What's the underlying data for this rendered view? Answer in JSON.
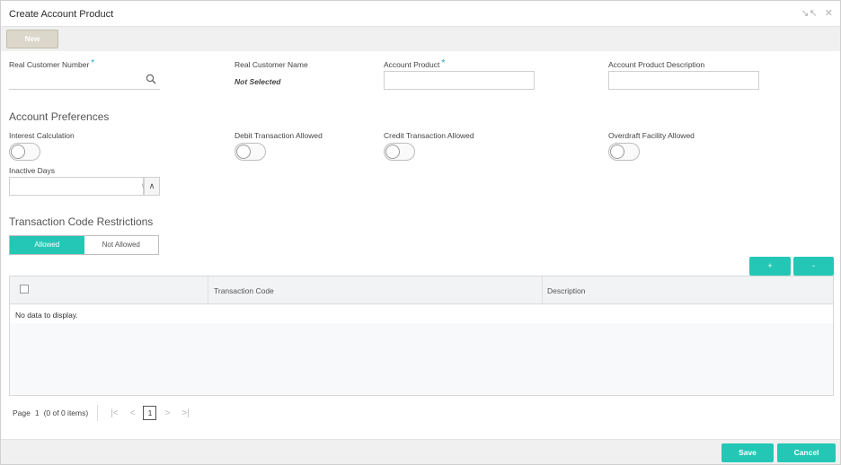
{
  "window": {
    "title": "Create Account Product",
    "minimize_icon": "collapse-arrows-icon",
    "close_icon": "close-icon"
  },
  "toolbar": {
    "new_label": "New"
  },
  "fields": {
    "real_customer_number": {
      "label": "Real Customer Number",
      "value": "",
      "required_mark": "*"
    },
    "real_customer_name": {
      "label": "Real Customer Name",
      "value": "Not Selected"
    },
    "account_product": {
      "label": "Account Product",
      "value": "",
      "required_mark": "*"
    },
    "account_product_description": {
      "label": "Account Product Description",
      "value": ""
    }
  },
  "preferences": {
    "title": "Account Preferences",
    "interest_calculation": {
      "label": "Interest Calculation",
      "on": false
    },
    "debit_transaction_allowed": {
      "label": "Debit Transaction Allowed",
      "on": false
    },
    "credit_transaction_allowed": {
      "label": "Credit Transaction Allowed",
      "on": false
    },
    "overdraft_facility_allowed": {
      "label": "Overdraft Facility Allowed",
      "on": false
    },
    "inactive_days": {
      "label": "Inactive Days",
      "value": ""
    }
  },
  "restrictions": {
    "title": "Transaction Code Restrictions",
    "options": [
      "Allowed",
      "Not Allowed"
    ],
    "selected": "Allowed",
    "add_label": "+",
    "remove_label": "-"
  },
  "table": {
    "columns": [
      "Transaction Code",
      "Description"
    ],
    "rows": [],
    "empty_text": "No data to display."
  },
  "pager": {
    "page_label": "Page",
    "current_page": "1",
    "items_text": "(0 of 0 items)",
    "page_box": "1"
  },
  "footer": {
    "save_label": "Save",
    "cancel_label": "Cancel"
  },
  "colors": {
    "accent": "#24c7b5",
    "required": "#1aa7c9",
    "new_button": "#dcd7cb"
  }
}
